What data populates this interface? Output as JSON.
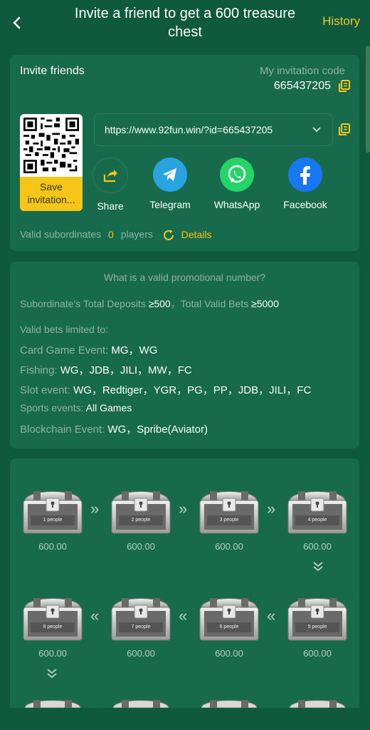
{
  "header": {
    "title": "Invite a friend to get a 600 treasure chest",
    "history": "History"
  },
  "invite": {
    "title": "Invite friends",
    "code_label": "My invitation code",
    "code_value": "665437205",
    "link": "https://www.92fun.win/?id=665437205",
    "save_label": "Save invitation...",
    "share": [
      {
        "label": "Share",
        "icon": "share-icon",
        "color": "#176b4c"
      },
      {
        "label": "Telegram",
        "icon": "telegram-icon",
        "color": "#2aa4e0"
      },
      {
        "label": "WhatsApp",
        "icon": "whatsapp-icon",
        "color": "#25d366"
      },
      {
        "label": "Facebook",
        "icon": "facebook-icon",
        "color": "#1877f2"
      }
    ],
    "valid_label": "Valid subordinates",
    "valid_count": "0",
    "players": "players",
    "details": "Details"
  },
  "rules": {
    "title": "What is a valid promotional number?",
    "deposit_label": "Subordinate's Total Deposits",
    "deposit_value": "≥500",
    "bets_label": "，Total Valid Bets",
    "bets_value": "≥5000",
    "limited": "Valid bets limited to:",
    "lines": [
      {
        "label": "Card Game Event:",
        "value": "MG，WG"
      },
      {
        "label": "Fishing:",
        "value": "WG，JDB，JILI，MW，FC"
      },
      {
        "label": "Slot event:",
        "value": "WG，Redtiger，YGR，PG，PP，JDB，JILI，FC"
      },
      {
        "label": "Sports events:",
        "value": "All Games"
      },
      {
        "label": "Blockchain Event:",
        "value": "WG，Spribe(Aviator)"
      }
    ]
  },
  "chests": [
    {
      "label": "1 people",
      "amount": "600.00"
    },
    {
      "label": "2 people",
      "amount": "600.00"
    },
    {
      "label": "3 people",
      "amount": "600.00"
    },
    {
      "label": "4 people",
      "amount": "600.00"
    },
    {
      "label": "5 people",
      "amount": "600.00"
    },
    {
      "label": "6 people",
      "amount": "600.00"
    },
    {
      "label": "7 people",
      "amount": "600.00"
    },
    {
      "label": "8 people",
      "amount": "600.00"
    }
  ],
  "colors": {
    "accent": "#f5c518",
    "background": "#0f5a3f",
    "card": "#176b4c"
  }
}
